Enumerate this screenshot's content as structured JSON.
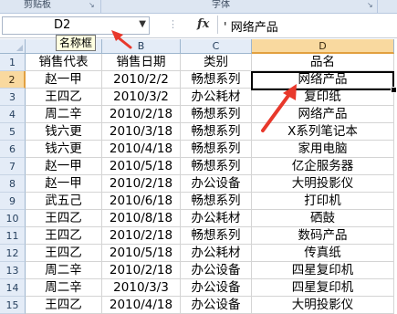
{
  "ribbon": {
    "groups": [
      {
        "label": "剪贴板"
      },
      {
        "label": "字体"
      }
    ]
  },
  "formula_bar": {
    "name_box_value": "D2",
    "fx_label": "fx",
    "formula_value": "' 网络产品"
  },
  "tooltip": "名称框",
  "columns": [
    "A",
    "B",
    "C",
    "D"
  ],
  "rows": [
    {
      "num": "1",
      "cells": [
        "销售代表",
        "销售日期",
        "类别",
        "品名"
      ]
    },
    {
      "num": "2",
      "cells": [
        "赵一甲",
        "2010/2/2",
        "畅想系列",
        "网络产品"
      ]
    },
    {
      "num": "3",
      "cells": [
        "王四乙",
        "2010/3/2",
        "办公耗材",
        "复印纸"
      ]
    },
    {
      "num": "4",
      "cells": [
        "周二辛",
        "2010/2/18",
        "畅想系列",
        "网络产品"
      ]
    },
    {
      "num": "5",
      "cells": [
        "钱六更",
        "2010/3/18",
        "畅想系列",
        "X系列笔记本"
      ]
    },
    {
      "num": "6",
      "cells": [
        "钱六更",
        "2010/4/18",
        "畅想系列",
        "家用电脑"
      ]
    },
    {
      "num": "7",
      "cells": [
        "赵一甲",
        "2010/5/18",
        "畅想系列",
        "亿企服务器"
      ]
    },
    {
      "num": "8",
      "cells": [
        "赵一甲",
        "2010/2/18",
        "办公设备",
        "大明投影仪"
      ]
    },
    {
      "num": "9",
      "cells": [
        "武五己",
        "2010/6/18",
        "畅想系列",
        "打印机"
      ]
    },
    {
      "num": "10",
      "cells": [
        "王四乙",
        "2010/8/18",
        "办公耗材",
        "硒鼓"
      ]
    },
    {
      "num": "11",
      "cells": [
        "王四乙",
        "2010/2/18",
        "畅想系列",
        "数码产品"
      ]
    },
    {
      "num": "12",
      "cells": [
        "王四乙",
        "2010/5/18",
        "办公耗材",
        "传真纸"
      ]
    },
    {
      "num": "13",
      "cells": [
        "周二辛",
        "2010/2/18",
        "办公设备",
        "四星复印机"
      ]
    },
    {
      "num": "14",
      "cells": [
        "周二辛",
        "2010/3/3",
        "办公设备",
        "四星复印机"
      ]
    },
    {
      "num": "15",
      "cells": [
        "王四乙",
        "2010/4/18",
        "办公设备",
        "大明投影仪"
      ]
    }
  ],
  "colors": {
    "header_bg": "#e4ecf7",
    "selected_header_bg": "#f9d99f",
    "annotation_arrow": "#e8382b"
  }
}
